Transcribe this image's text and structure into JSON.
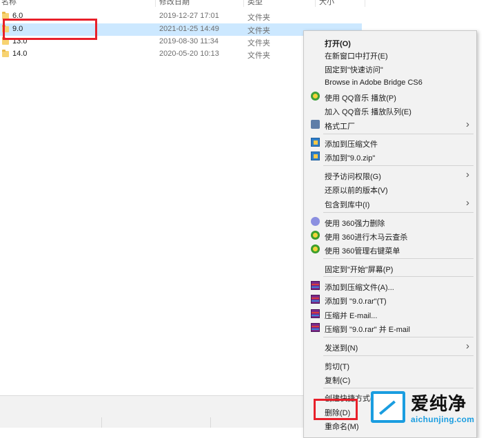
{
  "explorer": {
    "headers": [
      "名称",
      "修改日期",
      "类型",
      "大小"
    ],
    "files": [
      {
        "name": "6.0",
        "date": "2019-12-27 17:01",
        "type": "文件夹",
        "selected": false
      },
      {
        "name": "9.0",
        "date": "2021-01-25 14:49",
        "type": "文件夹",
        "selected": true
      },
      {
        "name": "13.0",
        "date": "2019-08-30 11:34",
        "type": "文件夹",
        "selected": false
      },
      {
        "name": "14.0",
        "date": "2020-05-20 10:13",
        "type": "文件夹",
        "selected": false
      }
    ]
  },
  "context_menu": {
    "items": [
      {
        "label": "打开(O)",
        "bold": true
      },
      {
        "label": "在新窗口中打开(E)"
      },
      {
        "label": "固定到\"快速访问\""
      },
      {
        "label": "Browse in Adobe Bridge CS6"
      },
      {
        "label": "使用 QQ音乐 播放(P)",
        "icon": "qq-music-icon"
      },
      {
        "label": "加入 QQ音乐 播放队列(E)"
      },
      {
        "label": "格式工厂",
        "icon": "format-factory-icon",
        "submenu": true
      },
      {
        "label": "添加到压缩文件",
        "icon": "zip-icon"
      },
      {
        "label": "添加到\"9.0.zip\"",
        "icon": "zip-icon"
      },
      {
        "label": "授予访问权限(G)",
        "submenu": true
      },
      {
        "label": "还原以前的版本(V)"
      },
      {
        "label": "包含到库中(I)",
        "submenu": true
      },
      {
        "label": "使用 360强力删除",
        "icon": "360-delete-icon"
      },
      {
        "label": "使用 360进行木马云查杀",
        "icon": "360-icon"
      },
      {
        "label": "使用 360管理右键菜单",
        "icon": "360-icon"
      },
      {
        "label": "固定到\"开始\"屏幕(P)"
      },
      {
        "label": "添加到压缩文件(A)...",
        "icon": "winrar-icon"
      },
      {
        "label": "添加到 \"9.0.rar\"(T)",
        "icon": "winrar-icon"
      },
      {
        "label": "压缩并 E-mail...",
        "icon": "winrar-icon"
      },
      {
        "label": "压缩到 \"9.0.rar\" 并 E-mail",
        "icon": "winrar-icon"
      },
      {
        "label": "发送到(N)",
        "submenu": true
      },
      {
        "label": "剪切(T)"
      },
      {
        "label": "复制(C)"
      },
      {
        "label": "创建快捷方式(S)"
      },
      {
        "label": "删除(D)"
      },
      {
        "label": "重命名(M)"
      }
    ]
  },
  "watermark": {
    "title": "爱纯净",
    "url": "aichunjing.com"
  },
  "colors": {
    "selection": "#cce8ff",
    "highlight_box": "#e8202a",
    "menu_bg": "#f2f2f2",
    "watermark_accent": "#1a9de0"
  }
}
